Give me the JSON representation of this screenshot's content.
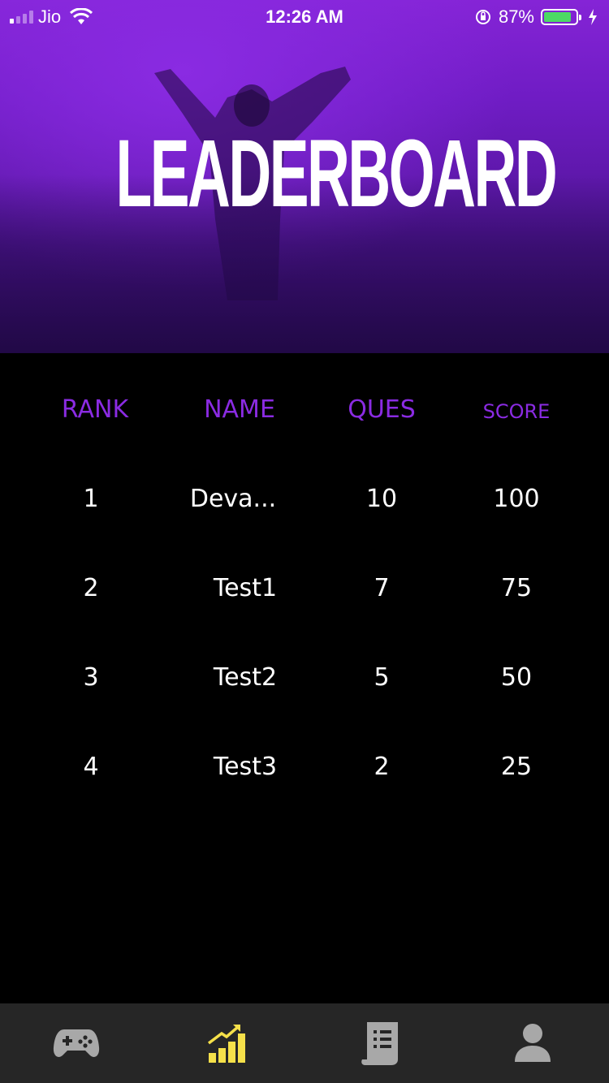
{
  "status_bar": {
    "carrier": "Jio",
    "time": "12:26 AM",
    "battery_percent": "87%",
    "battery_level": 0.87
  },
  "hero": {
    "title": "LEADERBOARD"
  },
  "table": {
    "headers": {
      "rank": "RANK",
      "name": "NAME",
      "ques": "QUES",
      "score": "SCORE"
    },
    "rows": [
      {
        "rank": "1",
        "name": "Deva...",
        "ques": "10",
        "score": "100"
      },
      {
        "rank": "2",
        "name": "Test1",
        "ques": "7",
        "score": "75"
      },
      {
        "rank": "3",
        "name": "Test2",
        "ques": "5",
        "score": "50"
      },
      {
        "rank": "4",
        "name": "Test3",
        "ques": "2",
        "score": "25"
      }
    ]
  },
  "tab_bar": {
    "active": "leaderboard",
    "items": [
      {
        "icon": "gamepad-icon"
      },
      {
        "icon": "chart-bars-icon"
      },
      {
        "icon": "document-list-icon"
      },
      {
        "icon": "user-icon"
      }
    ]
  },
  "colors": {
    "accent": "#8a2be2",
    "active_tab": "#f5e04a",
    "inactive_tab": "#a8a8a8",
    "background": "#000000",
    "tab_bar": "#262626"
  }
}
